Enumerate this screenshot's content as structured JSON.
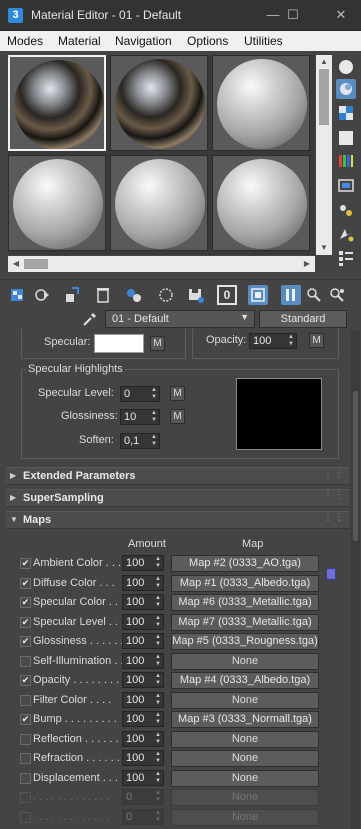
{
  "window": {
    "app_icon_text": "3",
    "title": "Material Editor - 01 - Default"
  },
  "menu": [
    "Modes",
    "Material",
    "Navigation",
    "Options",
    "Utilities"
  ],
  "sample_slots": [
    {
      "type": "reflective-sphere",
      "selected": true
    },
    {
      "type": "reflective-sphere",
      "selected": false
    },
    {
      "type": "gray-sphere",
      "selected": false
    },
    {
      "type": "gray-sphere",
      "selected": false
    },
    {
      "type": "gray-sphere",
      "selected": false
    },
    {
      "type": "gray-sphere",
      "selected": false
    }
  ],
  "side_tools": [
    "sample-sphere-icon",
    "backlight-icon",
    "checker-background-icon",
    "sample-uv-icon",
    "video-color-check-icon",
    "make-preview-icon",
    "options-icon",
    "select-by-material-icon",
    "material-navigator-icon"
  ],
  "toolbar_icons": [
    "get-material-icon",
    "put-to-scene-icon",
    "assign-to-selection-icon",
    "reset-map-icon",
    "make-unique-icon",
    "put-to-library-icon",
    "material-id-channel-icon",
    "show-shaded-icon",
    "show-end-result-icon",
    "go-to-parent-icon",
    "go-forward-icon"
  ],
  "material": {
    "name": "01 - Default",
    "type_button": "Standard",
    "id_channel": "0"
  },
  "basic": {
    "specular_label": "Specular:",
    "specular_color": "#ffffff",
    "opacity_label": "Opacity:",
    "opacity_value": "100",
    "m": "M"
  },
  "specular_highlights": {
    "title": "Specular Highlights",
    "level_label": "Specular Level:",
    "level_value": "0",
    "gloss_label": "Glossiness:",
    "gloss_value": "10",
    "soften_label": "Soften:",
    "soften_value": "0,1",
    "preview_color": "#000000"
  },
  "rollouts": {
    "extended": "Extended Parameters",
    "supersampling": "SuperSampling",
    "maps": "Maps"
  },
  "maps": {
    "amount_header": "Amount",
    "map_header": "Map",
    "rows": [
      {
        "label": "Ambient Color . . .",
        "checked": true,
        "amount": "100",
        "map": "Map #2 (0333_AO.tga)",
        "enabled": true
      },
      {
        "label": "Diffuse Color . . .",
        "checked": true,
        "amount": "100",
        "map": "Map #1 (0333_Albedo.tga)",
        "enabled": true
      },
      {
        "label": "Specular Color . .",
        "checked": true,
        "amount": "100",
        "map": "Map #6 (0333_Metallic.tga)",
        "enabled": true
      },
      {
        "label": "Specular Level . .",
        "checked": true,
        "amount": "100",
        "map": "Map #7 (0333_Metallic.tga)",
        "enabled": true
      },
      {
        "label": "Glossiness . . . . . .",
        "checked": true,
        "amount": "100",
        "map": "Map #5 (0333_Rougness.tga)",
        "enabled": true
      },
      {
        "label": "Self-Illumination . .",
        "checked": false,
        "amount": "100",
        "map": "None",
        "enabled": true
      },
      {
        "label": "Opacity . . . . . . . .",
        "checked": true,
        "amount": "100",
        "map": "Map #4 (0333_Albedo.tga)",
        "enabled": true
      },
      {
        "label": "Filter Color . . . .",
        "checked": false,
        "amount": "100",
        "map": "None",
        "enabled": true
      },
      {
        "label": "Bump . . . . . . . . .",
        "checked": true,
        "amount": "100",
        "map": "Map #3 (0333_Normall.tga)",
        "enabled": true
      },
      {
        "label": "Reflection . . . . . .",
        "checked": false,
        "amount": "100",
        "map": "None",
        "enabled": true
      },
      {
        "label": "Refraction . . . . . .",
        "checked": false,
        "amount": "100",
        "map": "None",
        "enabled": true
      },
      {
        "label": "Displacement . . . .",
        "checked": false,
        "amount": "100",
        "map": "None",
        "enabled": true
      },
      {
        "label": ". . . . . . . . . . . . .",
        "checked": false,
        "amount": "0",
        "map": "None",
        "enabled": false
      },
      {
        "label": ". . . . . . . . . . . . .",
        "checked": false,
        "amount": "0",
        "map": "None",
        "enabled": false
      }
    ]
  }
}
